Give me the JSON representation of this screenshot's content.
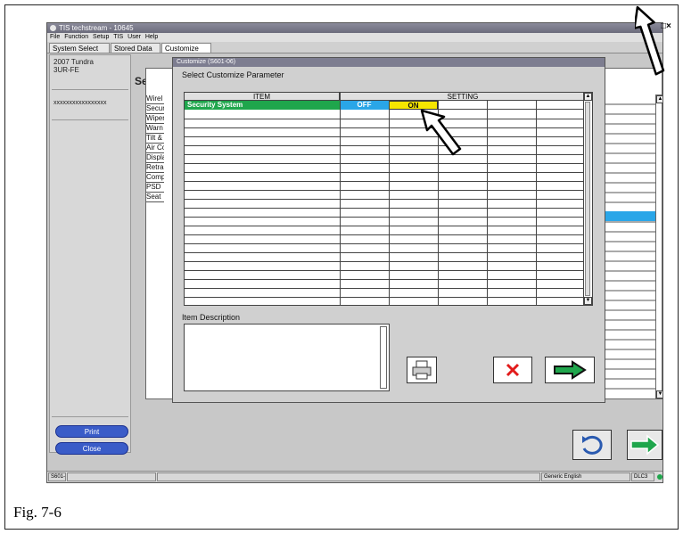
{
  "window": {
    "title": "TIS techstream - 10645"
  },
  "menu": [
    "File",
    "Function",
    "Setup",
    "TIS",
    "User",
    "Help"
  ],
  "tabs": [
    "System Select",
    "Stored Data",
    "Customize"
  ],
  "vehicle": {
    "model": "2007 Tundra",
    "engine": "3UR-FE",
    "vin": "xxxxxxxxxxxxxxxxx"
  },
  "left_buttons": {
    "print": "Print",
    "close": "Close"
  },
  "background": {
    "heading": "Sele",
    "items": [
      "Wirel",
      "Secur",
      "Wiper",
      "Warn",
      "Tilt &",
      "Air Co",
      "Displa",
      "Retra",
      "Comp",
      "PSD",
      "Seat"
    ]
  },
  "dialog": {
    "title": "Customize (S601-06)",
    "subtitle": "Select Customize Parameter",
    "table": {
      "headers": {
        "item": "ITEM",
        "setting": "SETTING"
      },
      "row": {
        "item": "Security System",
        "off": "OFF",
        "on": "ON"
      }
    },
    "description_label": "Item Description"
  },
  "statusbar": {
    "code": "S601-05",
    "language": "Generic English",
    "port": "DLC3"
  },
  "caption": "Fig. 7-6",
  "colors": {
    "selected_row": "#1fa64c",
    "off_cell": "#2aa6e8",
    "on_cell": "#f5e600",
    "pill_button": "#3a5cc8"
  },
  "icons": [
    "printer-icon",
    "cancel-x-icon",
    "next-arrow-icon",
    "back-icon",
    "forward-arrow-icon",
    "pointer-arrow-icon"
  ]
}
